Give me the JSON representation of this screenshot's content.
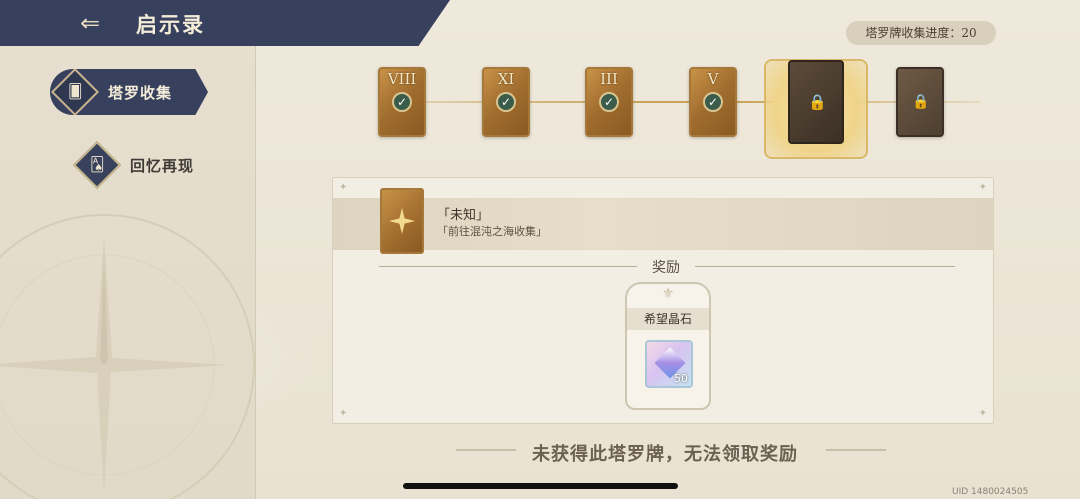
{
  "header": {
    "title": "启示录",
    "back_icon": "back-arrow-icon"
  },
  "sidebar": {
    "items": [
      {
        "label": "塔罗收集",
        "icon": "tarot-cards-icon",
        "active": true
      },
      {
        "label": "回忆再现",
        "icon": "memory-card-icon",
        "active": false
      }
    ]
  },
  "progress": {
    "label": "塔罗牌收集进度：",
    "value": "20"
  },
  "cards": [
    {
      "numeral": "VIII",
      "state": "collected"
    },
    {
      "numeral": "XI",
      "state": "collected"
    },
    {
      "numeral": "III",
      "state": "collected"
    },
    {
      "numeral": "V",
      "state": "collected"
    },
    {
      "numeral": "",
      "state": "locked-selected"
    },
    {
      "numeral": "",
      "state": "locked"
    }
  ],
  "detail": {
    "title": "「未知」",
    "description": "「前往混沌之海收集」"
  },
  "reward": {
    "header": "奖励",
    "name": "希望晶石",
    "quantity": "50"
  },
  "notice": "未获得此塔罗牌，无法领取奖励",
  "uid": "UID 1480024505",
  "colors": {
    "header_bg": "#37415e",
    "card_gold": "#a06c2e",
    "card_locked": "#4e3f31",
    "check_green": "#3b5c4a"
  }
}
